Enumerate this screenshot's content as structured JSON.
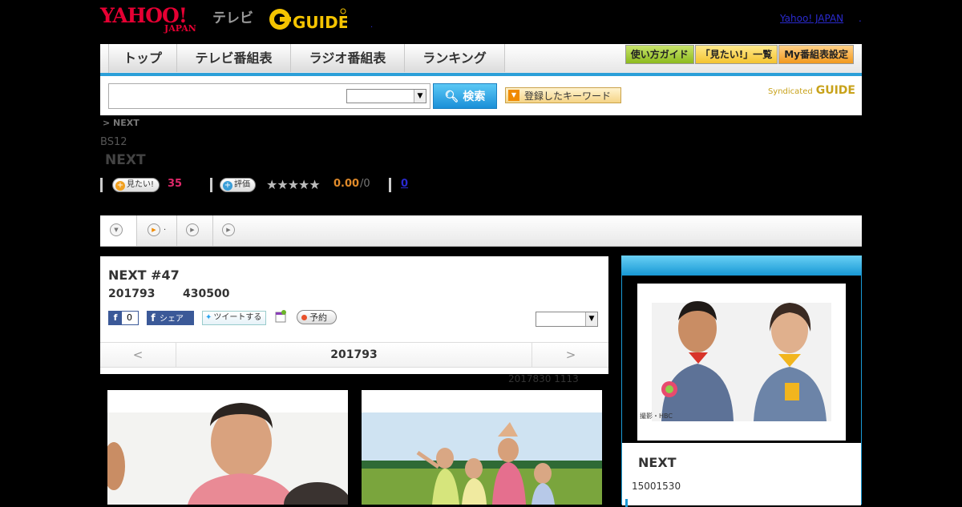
{
  "header": {
    "yahoo_logo": "YAHOO!",
    "yahoo_sub": "JAPAN",
    "tv_label": "テレビ",
    "guide_logo": "GUIDE",
    "yahoo_japan_link": "Yahoo! JAPAN",
    "dot": ".",
    "tiny_dot": "."
  },
  "nav": {
    "tabs": [
      "トップ",
      "テレビ番組表",
      "ラジオ番組表",
      "ランキング"
    ],
    "buttons": [
      "使い方ガイド",
      "「見たい!」一覧",
      "My番組表設定"
    ]
  },
  "search": {
    "input_value": "",
    "select_value": "",
    "button_label": "検索",
    "keyword_button": "登録したキーワード",
    "syndicated": "Syndicated",
    "syndicated_logo": "GUIDE"
  },
  "program": {
    "breadcrumb": ">  NEXT",
    "channel": "BS12",
    "title": "NEXT",
    "mitai_label": "見たい!",
    "mitai_count": "35",
    "rate_label": "評価",
    "stars": "★★★★★",
    "score": "0.00",
    "score_max": "/0",
    "review_count": "0"
  },
  "content_tabs": [
    ".",
    ""
  ],
  "episode": {
    "title": "NEXT #47",
    "date": "201793",
    "time": "430500",
    "fb_count": "0",
    "fb_share": "シェア",
    "tweet": "ツイートする",
    "reserve": "予約",
    "select_value": "",
    "prev": "<",
    "current": "201793",
    "next": ">",
    "updated": "2017830  1113"
  },
  "side": {
    "photo_credit": "撮影・HBC",
    "title": "NEXT",
    "time": "15001530"
  },
  "colors": {
    "accent": "#2b9fd8",
    "yahoo_red": "#e60033",
    "guide_yellow": "#f5c400",
    "count_pink": "#e0286a",
    "score_orange": "#e08a2a"
  }
}
